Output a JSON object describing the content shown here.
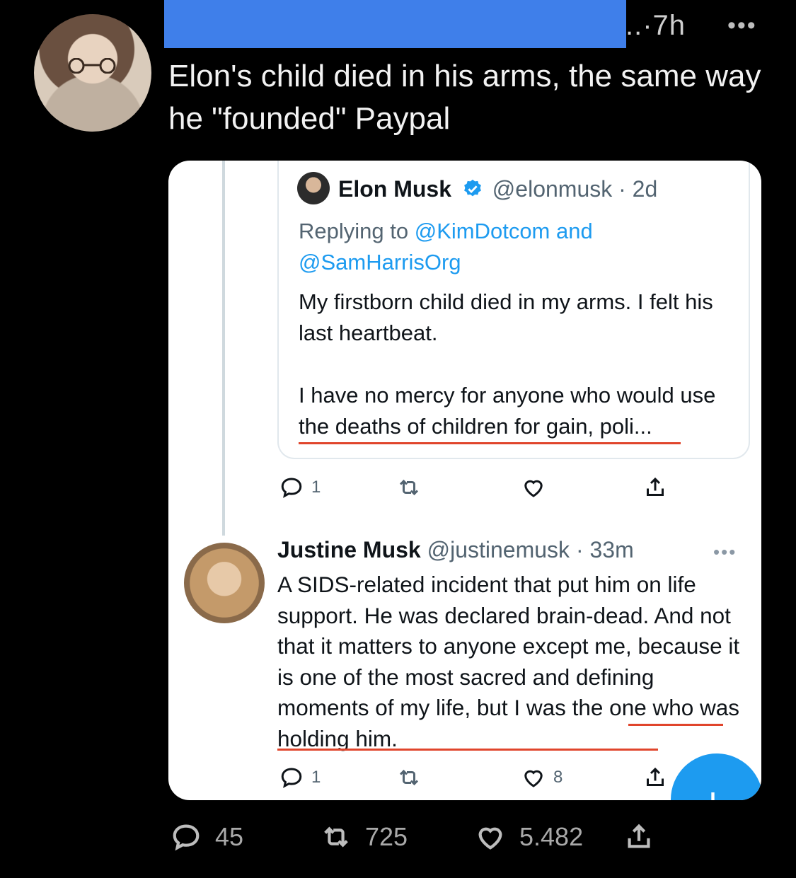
{
  "header": {
    "timestamp": "..·7h",
    "more": "•••"
  },
  "tweet": {
    "text": "Elon's child died in his arms, the same way he \"founded\" Paypal",
    "stats": {
      "replies": "45",
      "retweets": "725",
      "likes": "5.482"
    }
  },
  "screenshot": {
    "quoted": {
      "name": "Elon Musk",
      "handle": "@elonmusk",
      "age": "· 2d",
      "replying_prefix": "Replying to",
      "reply_to_1": "@KimDotcom",
      "and_word": "and",
      "reply_to_2": "@SamHarrisOrg",
      "paragraph_1": "My firstborn child died in my arms. I felt his last heartbeat.",
      "paragraph_2": "I have no mercy for anyone who would use the deaths of children for gain, poli..."
    },
    "thread_actions": {
      "replies": "1"
    },
    "reply": {
      "name": "Justine Musk",
      "handle": "@justinemusk",
      "age": "· 33m",
      "more": "•••",
      "body": "A SIDS-related incident that put him on life support. He was declared brain-dead. And not that it matters to anyone except me, because it is one of the most sacred and defining moments of my life, but I was the one who was holding him.",
      "replies": "1",
      "likes": "8"
    },
    "fab_label": "+"
  },
  "colors": {
    "redaction": "#3f7fea",
    "link": "#1d9bf0",
    "underline": "#e0452c"
  }
}
